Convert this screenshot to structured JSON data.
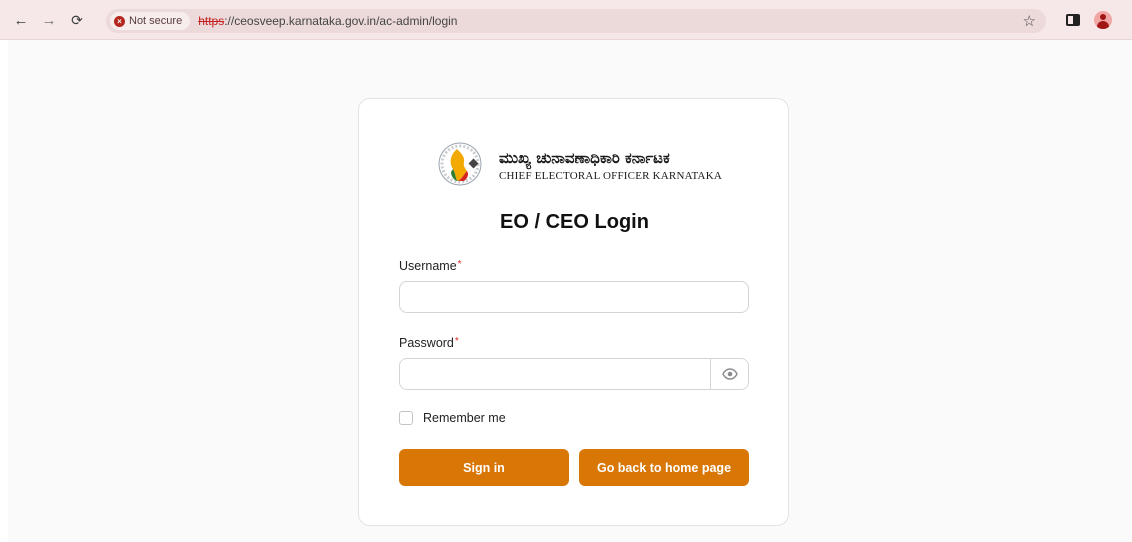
{
  "browser": {
    "security_label": "Not secure",
    "url_scheme": "https",
    "url_rest": "://ceosveep.karnataka.gov.in/ac-admin/login",
    "icons": {
      "back": "arrow-left-icon",
      "forward": "arrow-right-icon",
      "reload": "reload-icon",
      "bookmark": "star-icon",
      "side_panel": "side-panel-icon",
      "profile": "profile-icon"
    }
  },
  "brand": {
    "name_kannada": "ಮುಖ್ಯ ಚುನಾವಣಾಧಿಕಾರಿ ಕರ್ನಾಟಕ",
    "name_english": "CHIEF ELECTORAL OFFICER KARNATAKA"
  },
  "login": {
    "title": "EO / CEO Login",
    "username_label": "Username",
    "username_value": "",
    "password_label": "Password",
    "password_value": "",
    "required_mark": "*",
    "remember_label": "Remember me",
    "remember_checked": false,
    "signin_label": "Sign in",
    "home_label": "Go back to home page"
  },
  "colors": {
    "accent": "#d97706",
    "required": "#dc2626",
    "browser_bar": "#f6e8e8",
    "security_warning": "#b3261e"
  }
}
